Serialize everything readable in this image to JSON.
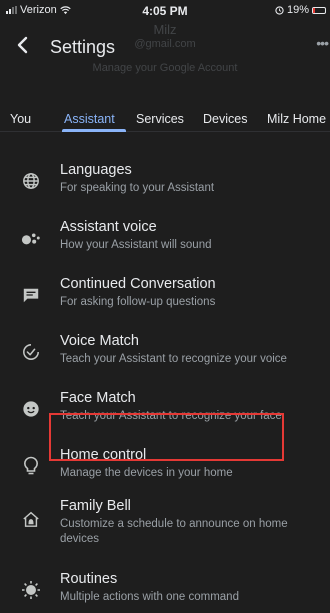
{
  "status_bar": {
    "carrier": "Verizon",
    "time": "4:05 PM",
    "battery": "19%",
    "battery_level": 0.19,
    "battery_color": "#e53935"
  },
  "header": {
    "title": "Settings",
    "ghost_name": "Milz",
    "ghost_email": "@gmail.com",
    "ghost_manage": "Manage your Google Account"
  },
  "tabs": [
    {
      "label": "You",
      "active": false
    },
    {
      "label": "Assistant",
      "active": true
    },
    {
      "label": "Services",
      "active": false
    },
    {
      "label": "Devices",
      "active": false
    },
    {
      "label": "Milz Home",
      "active": false
    }
  ],
  "settings": [
    {
      "title": "Languages",
      "subtitle": "For speaking to your Assistant",
      "icon": "globe-icon"
    },
    {
      "title": "Assistant voice",
      "subtitle": "How your Assistant will sound",
      "icon": "assistant-dots-icon"
    },
    {
      "title": "Continued Conversation",
      "subtitle": "For asking follow-up questions",
      "icon": "chat-bubble-icon"
    },
    {
      "title": "Voice Match",
      "subtitle": "Teach your Assistant to recognize your voice",
      "icon": "voice-match-icon"
    },
    {
      "title": "Face Match",
      "subtitle": "Teach your Assistant to recognize your face",
      "icon": "face-icon"
    },
    {
      "title": "Home control",
      "subtitle": "Manage the devices in your home",
      "icon": "lightbulb-icon"
    },
    {
      "title": "Family Bell",
      "subtitle": "Customize a schedule to announce on home devices",
      "icon": "home-bell-icon"
    },
    {
      "title": "Routines",
      "subtitle": "Multiple actions with one command",
      "icon": "routines-icon"
    }
  ],
  "colors": {
    "accent": "#8ab4f8",
    "highlight": "#e53935",
    "background": "#1e1e1e"
  }
}
